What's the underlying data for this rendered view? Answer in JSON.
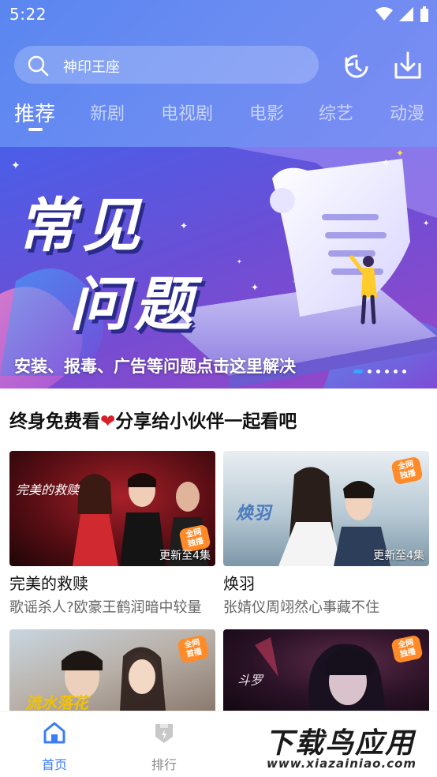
{
  "status_bar": {
    "time": "5:22"
  },
  "search": {
    "placeholder": "神印王座"
  },
  "tabs": [
    {
      "label": "推荐",
      "active": true
    },
    {
      "label": "新剧"
    },
    {
      "label": "电视剧"
    },
    {
      "label": "电影"
    },
    {
      "label": "综艺"
    },
    {
      "label": "动漫"
    }
  ],
  "banner": {
    "title_line1": "常见",
    "title_line2": "问题",
    "caption": "安装、报毒、广告等问题点击这里解决",
    "slide_count": 6,
    "active_slide": 0
  },
  "section": {
    "title_before": "终身免费看",
    "heart": "❤",
    "title_after": "分享给小伙伴一起看吧"
  },
  "cards": [
    {
      "title": "完美的救赎",
      "subtitle": "歌谣杀人?欧豪王鹤润暗中较量",
      "episode": "更新至4集",
      "poster_text": "完美的救赎",
      "badge": "全网\n独播"
    },
    {
      "title": "焕羽",
      "subtitle": "张婧仪周翊然心事藏不住",
      "episode": "更新至4集",
      "poster_text": "焕羽",
      "badge": "全网\n独播"
    },
    {
      "title": "",
      "subtitle": "",
      "episode": "",
      "poster_text": "",
      "badge": "全网\n首播"
    },
    {
      "title": "",
      "subtitle": "",
      "episode": "",
      "poster_text": "",
      "badge": "全网\n独播"
    }
  ],
  "bottom_nav": [
    {
      "label": "首页",
      "icon": "home-icon",
      "active": true
    },
    {
      "label": "排行",
      "icon": "ranking-icon"
    }
  ],
  "watermark": {
    "main": "下载鸟应用",
    "sub": "www.xiazainiao.com"
  },
  "colors": {
    "accent": "#3a7ef5",
    "header": "#6b8cf2",
    "badge": "#ff8a28"
  }
}
